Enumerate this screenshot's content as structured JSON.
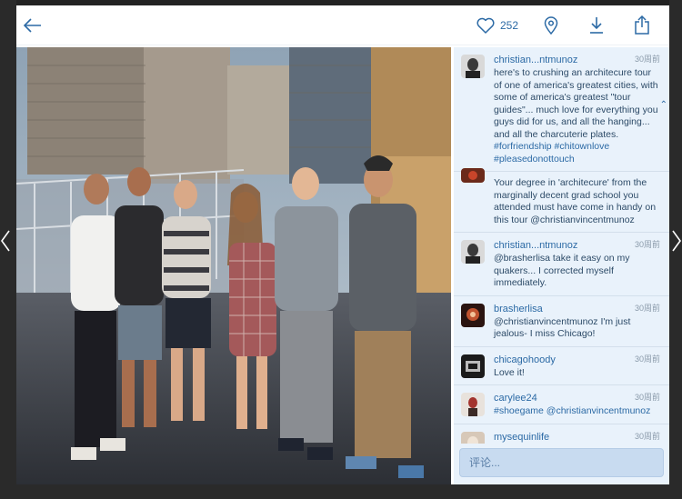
{
  "likes": {
    "count": "252"
  },
  "comments": [
    {
      "user": "christian...ntmunoz",
      "time": "30周前",
      "text": "here's to crushing an architecure tour of one of america's greatest cities, with some of america's greatest \"tour guides\"... much love for everything you guys did for us, and all the hanging... and all the charcuterie plates.",
      "tags": "#forfriendship #chitownlove #pleasedonottouch"
    },
    {
      "user": "",
      "time": "",
      "text": "Your degree in 'architecure' from the marginally decent grad school you attended must have come in handy on this tour @christianvincentmunoz"
    },
    {
      "user": "christian...ntmunoz",
      "time": "30周前",
      "text": "@brasherlisa take it easy on my quakers... I corrected myself immediately."
    },
    {
      "user": "brasherlisa",
      "time": "30周前",
      "text": "@christianvincentmunoz I'm just jealous- I miss Chicago!"
    },
    {
      "user": "chicagohoody",
      "time": "30周前",
      "text": "Love it!"
    },
    {
      "user": "carylee24",
      "time": "30周前",
      "text": "#shoegame @christianvincentmunoz"
    },
    {
      "user": "mysequinlife",
      "time": "30周前",
      "text": ""
    }
  ],
  "comment_input": {
    "placeholder": "评论..."
  },
  "colors": {
    "accent": "#2c6aa5",
    "panel_bg": "#e9f2fb",
    "input_bg": "#c8dbf0"
  },
  "icons": [
    "back-arrow-icon",
    "heart-icon",
    "location-pin-icon",
    "download-icon",
    "share-icon",
    "chevron-left-icon",
    "chevron-right-icon"
  ]
}
